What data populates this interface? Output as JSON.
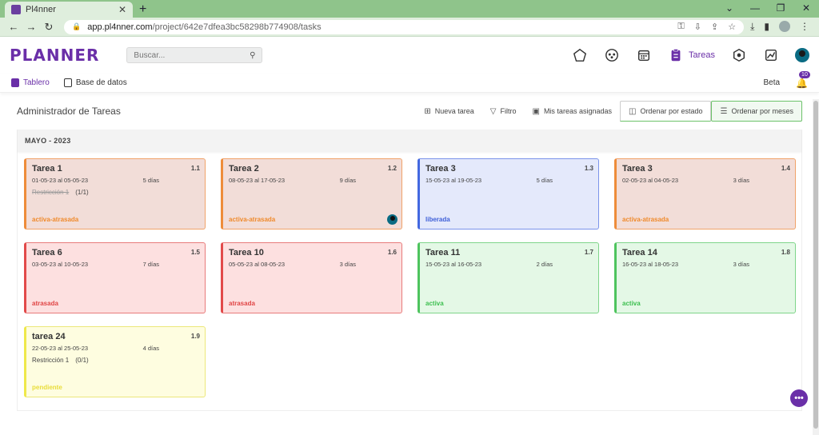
{
  "browser": {
    "tab_title": "Pl4nner",
    "url_host": "app.pl4nner.com",
    "url_path": "/project/642e7dfea3bc58298b774908/tasks"
  },
  "app": {
    "logo": "PLANNER",
    "search_placeholder": "Buscar...",
    "nav_active_label": "Tareas"
  },
  "subnav": {
    "tablero": "Tablero",
    "base_datos": "Base de datos",
    "beta": "Beta",
    "notif_count": "10"
  },
  "toolbar": {
    "title": "Administrador de Tareas",
    "nueva_tarea": "Nueva tarea",
    "filtro": "Filtro",
    "mis_tareas": "Mis tareas asignadas",
    "ordenar_estado": "Ordenar por estado",
    "ordenar_meses": "Ordenar por meses"
  },
  "board": {
    "month": "MAYO - 2023",
    "cards": [
      {
        "name": "Tarea 1",
        "code": "1.1",
        "dates": "01-05-23 al 05-05-23",
        "days": "5 días",
        "restriction": "Restricción 1",
        "restriction_count": "(1/1)",
        "restriction_done": true,
        "status": "activa-atrasada",
        "color": "orange",
        "assigned": false
      },
      {
        "name": "Tarea 2",
        "code": "1.2",
        "dates": "08-05-23 al 17-05-23",
        "days": "9 días",
        "restriction": "",
        "restriction_count": "",
        "restriction_done": false,
        "status": "activa-atrasada",
        "color": "orange",
        "assigned": true
      },
      {
        "name": "Tarea 3",
        "code": "1.3",
        "dates": "15-05-23 al 19-05-23",
        "days": "5 días",
        "restriction": "",
        "restriction_count": "",
        "restriction_done": false,
        "status": "liberada",
        "color": "blue",
        "assigned": false
      },
      {
        "name": "Tarea 3",
        "code": "1.4",
        "dates": "02-05-23 al 04-05-23",
        "days": "3 días",
        "restriction": "",
        "restriction_count": "",
        "restriction_done": false,
        "status": "activa-atrasada",
        "color": "orange",
        "assigned": false
      },
      {
        "name": "Tarea 6",
        "code": "1.5",
        "dates": "03-05-23 al 10-05-23",
        "days": "7 días",
        "restriction": "",
        "restriction_count": "",
        "restriction_done": false,
        "status": "atrasada",
        "color": "red",
        "assigned": false
      },
      {
        "name": "Tarea 10",
        "code": "1.6",
        "dates": "05-05-23 al 08-05-23",
        "days": "3 días",
        "restriction": "",
        "restriction_count": "",
        "restriction_done": false,
        "status": "atrasada",
        "color": "red",
        "assigned": false
      },
      {
        "name": "Tarea 11",
        "code": "1.7",
        "dates": "15-05-23 al 16-05-23",
        "days": "2 días",
        "restriction": "",
        "restriction_count": "",
        "restriction_done": false,
        "status": "activa",
        "color": "green",
        "assigned": false
      },
      {
        "name": "Tarea 14",
        "code": "1.8",
        "dates": "16-05-23 al 18-05-23",
        "days": "3 días",
        "restriction": "",
        "restriction_count": "",
        "restriction_done": false,
        "status": "activa",
        "color": "green",
        "assigned": false
      },
      {
        "name": "tarea 24",
        "code": "1.9",
        "dates": "22-05-23 al 25-05-23",
        "days": "4 días",
        "restriction": "Restricción 1",
        "restriction_count": "(0/1)",
        "restriction_done": false,
        "status": "pendiente",
        "color": "yellow",
        "assigned": false
      }
    ]
  }
}
